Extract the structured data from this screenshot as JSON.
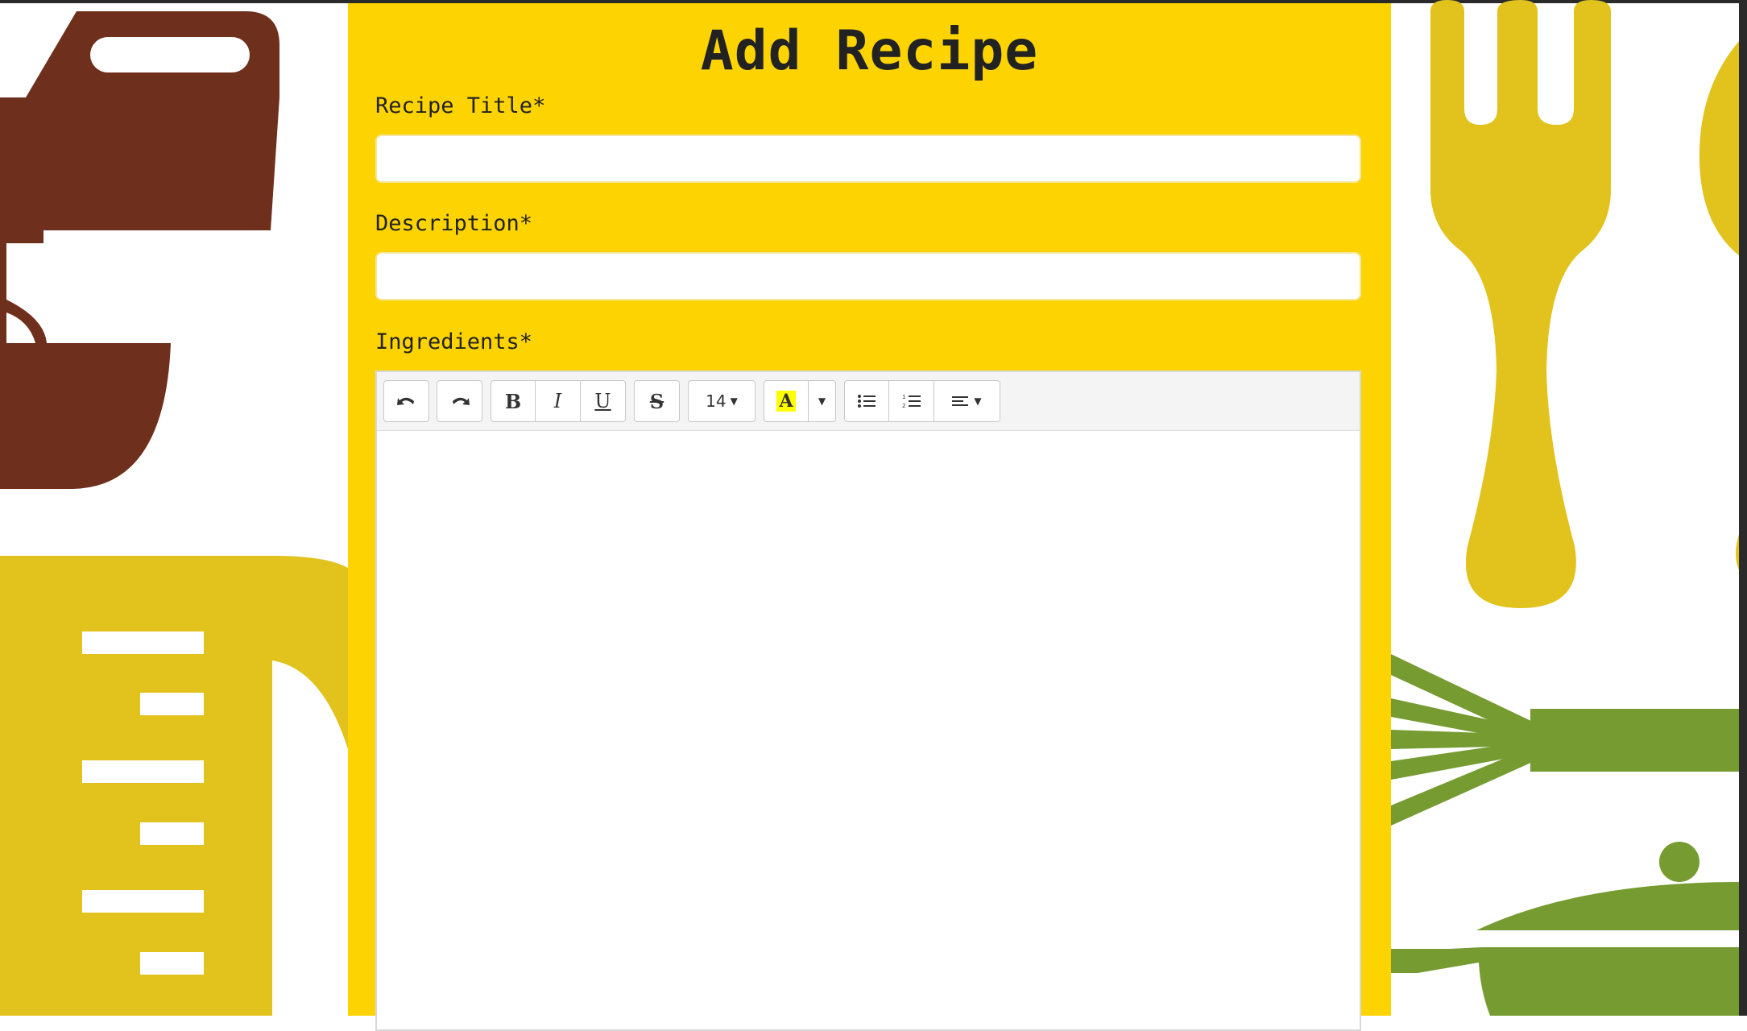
{
  "page": {
    "title": "Add Recipe"
  },
  "form": {
    "recipe_title": {
      "label": "Recipe Title*",
      "value": "",
      "placeholder": ""
    },
    "description": {
      "label": "Description*",
      "value": "",
      "placeholder": ""
    },
    "ingredients": {
      "label": "Ingredients*",
      "value": ""
    }
  },
  "editor_toolbar": {
    "undo_icon": "undo-icon",
    "redo_icon": "redo-icon",
    "bold_label": "B",
    "italic_label": "I",
    "underline_label": "U",
    "strikethrough_label": "S",
    "font_size": "14",
    "highlight_label": "A",
    "highlight_color": "#ffff00",
    "unordered_list_icon": "bullet-list-icon",
    "ordered_list_icon": "numbered-list-icon",
    "align_icon": "align-left-icon"
  },
  "colors": {
    "panel": "#fdd402",
    "mixer_brown": "#6e2f1c",
    "cup_yellow": "#e2c21c",
    "whisk_green": "#759b31"
  }
}
